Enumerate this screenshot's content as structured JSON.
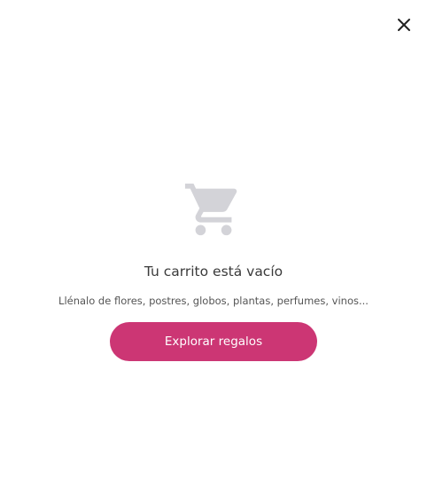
{
  "cart": {
    "empty_title": "Tu carrito está vacío",
    "empty_subtitle": "Llénalo de flores, postres, globos, plantas, perfumes, vinos...",
    "cta_label": "Explorar regalos"
  },
  "icons": {
    "close": "close-icon",
    "cart": "shopping-cart-icon"
  },
  "colors": {
    "accent": "#cc3674",
    "icon_gray": "#d3d3d8",
    "close_icon": "#222222"
  }
}
